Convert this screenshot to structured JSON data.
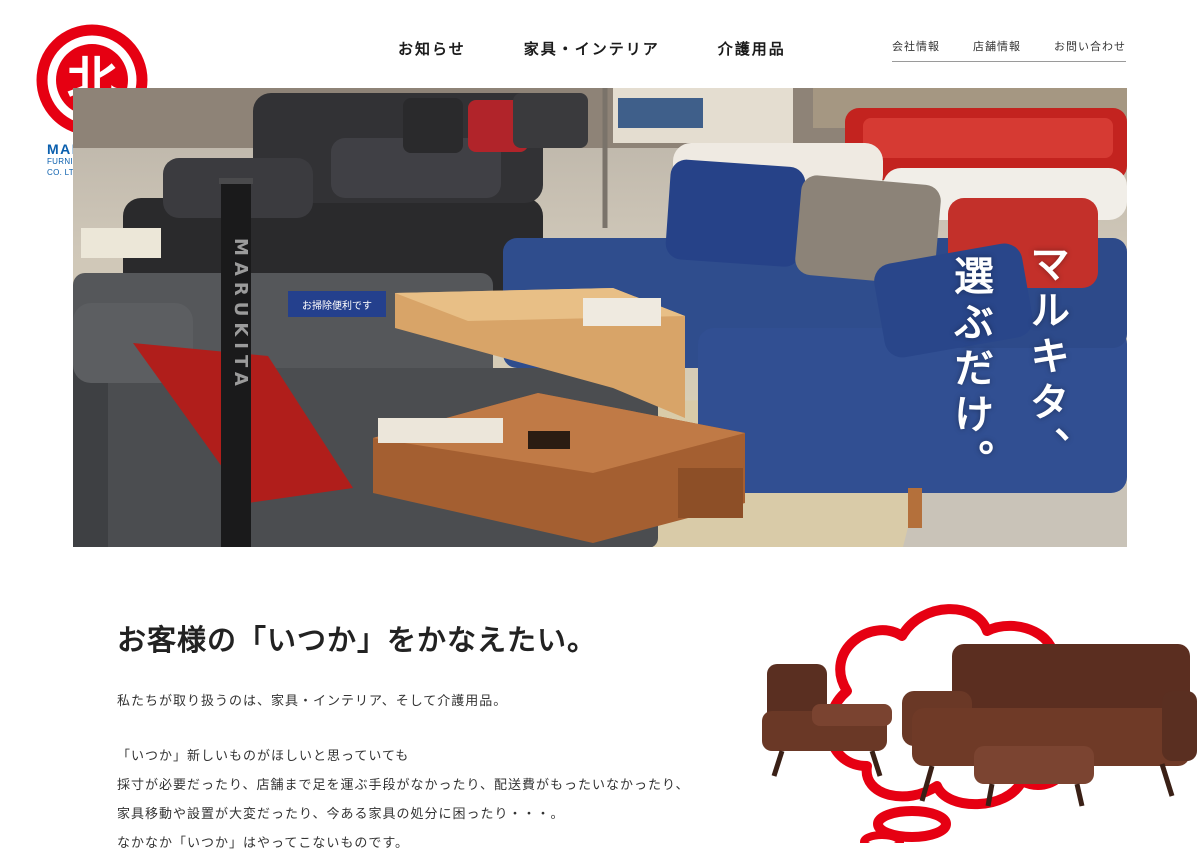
{
  "logo": {
    "mark": "北",
    "name": "MARUKITA",
    "sub_line1": "FURNITURE CENTER",
    "sub_line2": "CO. LTD"
  },
  "main_nav": [
    "お知らせ",
    "家具・インテリア",
    "介護用品"
  ],
  "sub_nav": [
    "会社情報",
    "店舗情報",
    "お問い合わせ"
  ],
  "hero": {
    "catch_line1": "マルキタ、",
    "catch_line2": "選ぶだけ。",
    "pillar_sign": "MARUKITA",
    "sofa_tag": "お掃除便利です"
  },
  "intro": {
    "heading": "お客様の「いつか」をかなえたい。",
    "lead": "私たちが取り扱うのは、家具・インテリア、そして介護用品。",
    "body": [
      "「いつか」新しいものがほしいと思っていても",
      "採寸が必要だったり、店舗まで足を運ぶ手段がなかったり、配送費がもったいなかったり、",
      "家具移動や設置が大変だったり、今ある家具の処分に困ったり・・・。",
      "なかなか「いつか」はやってこないものです。"
    ]
  },
  "colors": {
    "brand_red": "#e60012",
    "brand_blue": "#0a5fae",
    "text": "#222222"
  }
}
